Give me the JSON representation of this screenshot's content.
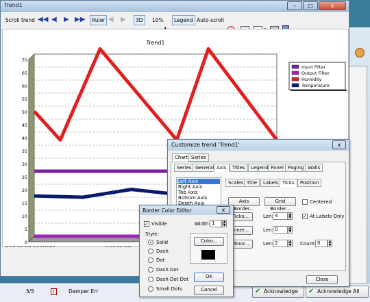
{
  "window": {
    "title": "Trend1",
    "min": "–",
    "max": "□",
    "close": "x"
  },
  "toolbar": {
    "scroll_label": "Scroll trend",
    "ruler": "Ruler",
    "three_d": "3D",
    "zoom_value": "10%",
    "legend": "Legend",
    "autoscroll": "Auto-scroll"
  },
  "chart_data": {
    "type": "line",
    "title": "Trend1",
    "x": [
      "8:57:33 AM 3/17/2009",
      "8:59:00 AM"
    ],
    "ylim": [
      0,
      70
    ],
    "yticks": [
      0,
      5,
      10,
      15,
      20,
      25,
      30,
      35,
      40,
      45,
      50,
      55,
      60,
      65,
      70
    ],
    "legend_position": "top-right",
    "series": [
      {
        "name": "Input Filter",
        "color": "#7b1fa2",
        "values": [
          25,
          25,
          25,
          25
        ]
      },
      {
        "name": "Output Filter",
        "color": "#9c27b0",
        "values": [
          0,
          0,
          0,
          0
        ]
      },
      {
        "name": "Humidity",
        "color": "#e02020",
        "values": [
          48,
          37,
          72,
          37,
          72,
          37
        ]
      },
      {
        "name": "Temperature",
        "color": "#0a1a6a",
        "values": [
          15.5,
          15,
          18,
          16,
          15.5,
          15
        ]
      }
    ]
  },
  "customize": {
    "title": "Customize trend 'Trend1'",
    "close": "x",
    "top_tabs": [
      "Chart",
      "Series"
    ],
    "tabs": [
      "Series",
      "General",
      "Axis",
      "Titles",
      "Legend",
      "Panel",
      "Paging",
      "Walls"
    ],
    "axis_list": [
      "Left Axis",
      "Right Axis",
      "Top Axis",
      "Bottom Axis",
      "Depth Axis"
    ],
    "sub_tabs": [
      "Scales",
      "Title",
      "Labels",
      "Ticks",
      "Position"
    ],
    "axis_border": "Axis Border...",
    "grid_border": "Grid Border...",
    "centered": "Centered",
    "ticks": "Ticks...",
    "inner": "Inner...",
    "minor": "Minor...",
    "len_label": "Len:",
    "len1": "4",
    "len2": "0",
    "len3": "2",
    "at_labels_only": "At Labels Only",
    "count_label": "Count:",
    "count": "0",
    "close_btn": "Close"
  },
  "border_editor": {
    "title": "Border Color Editor",
    "close": "x",
    "visible": "Visible",
    "width_label": "Width:",
    "width": "1",
    "style_label": "Style:",
    "styles": [
      "Solid",
      "Dash",
      "Dot",
      "Dash Dot",
      "Dash Dot Dot",
      "Small Dots"
    ],
    "color_btn": "Color...",
    "ok": "OK",
    "cancel": "Cancel"
  },
  "statusbar": {
    "count": "5/5",
    "alarm": "Damper Err",
    "ack": "Acknowledge",
    "ack_all": "Acknowledge All"
  }
}
